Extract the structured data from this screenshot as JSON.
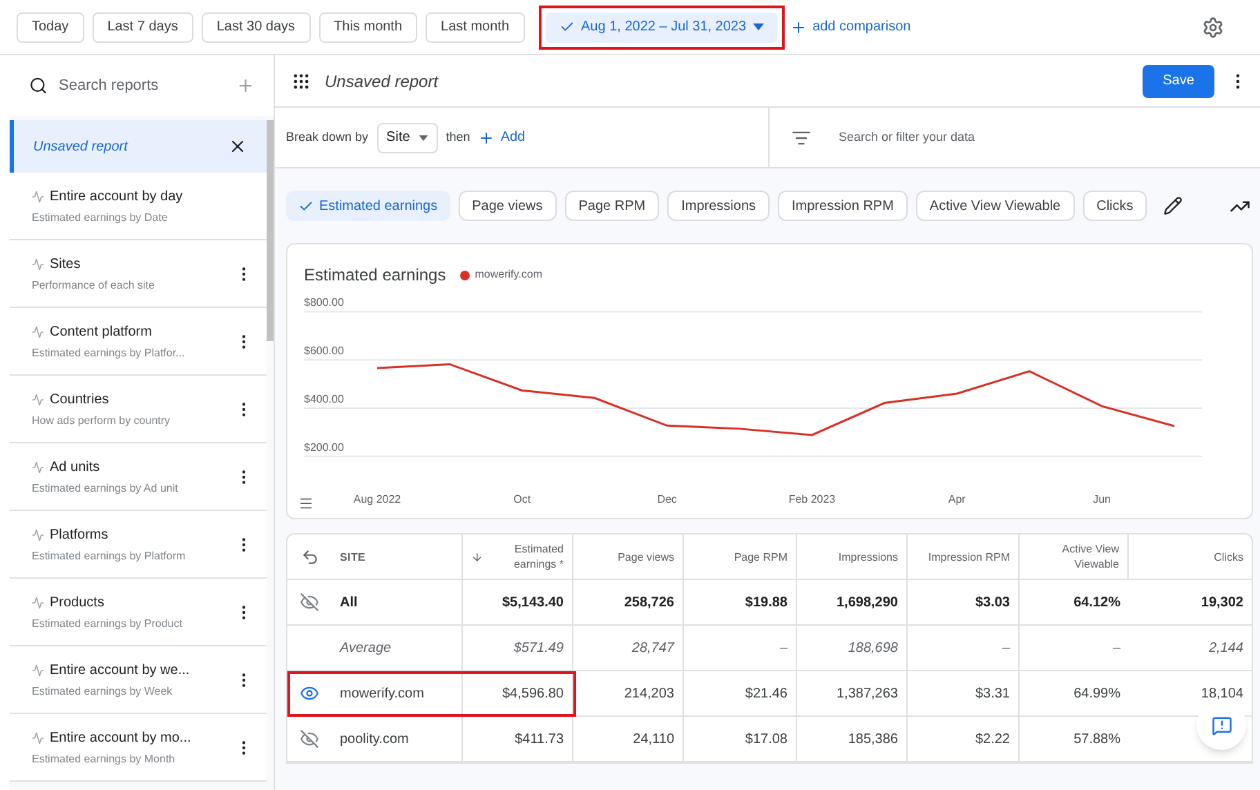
{
  "date_presets": [
    {
      "label": "Today",
      "selected": false
    },
    {
      "label": "Last 7 days",
      "selected": false
    },
    {
      "label": "Last 30 days",
      "selected": false
    },
    {
      "label": "This month",
      "selected": false
    },
    {
      "label": "Last month",
      "selected": false
    }
  ],
  "date_range": {
    "label": "Aug 1, 2022 – Jul 31, 2023",
    "selected": true,
    "highlighted": true
  },
  "add_comparison": "add comparison",
  "sidebar": {
    "search_placeholder": "Search reports",
    "active_report": "Unsaved report",
    "items": [
      {
        "title": "Entire account by day",
        "subtitle": "Estimated earnings by Date",
        "has_menu": false
      },
      {
        "title": "Sites",
        "subtitle": "Performance of each site",
        "has_menu": true
      },
      {
        "title": "Content platform",
        "subtitle": "Estimated earnings by Platfor...",
        "has_menu": true
      },
      {
        "title": "Countries",
        "subtitle": "How ads perform by country",
        "has_menu": true
      },
      {
        "title": "Ad units",
        "subtitle": "Estimated earnings by Ad unit",
        "has_menu": true
      },
      {
        "title": "Platforms",
        "subtitle": "Estimated earnings by Platform",
        "has_menu": true
      },
      {
        "title": "Products",
        "subtitle": "Estimated earnings by Product",
        "has_menu": true
      },
      {
        "title": "Entire account by we...",
        "subtitle": "Estimated earnings by Week",
        "has_menu": true
      },
      {
        "title": "Entire account by mo...",
        "subtitle": "Estimated earnings by Month",
        "has_menu": true
      }
    ]
  },
  "report": {
    "title": "Unsaved report",
    "save": "Save"
  },
  "breakdown": {
    "label": "Break down by",
    "value": "Site",
    "then": "then",
    "add": "Add",
    "filter_placeholder": "Search or filter your data"
  },
  "metrics": [
    {
      "label": "Estimated earnings",
      "selected": true
    },
    {
      "label": "Page views",
      "selected": false
    },
    {
      "label": "Page RPM",
      "selected": false
    },
    {
      "label": "Impressions",
      "selected": false
    },
    {
      "label": "Impression RPM",
      "selected": false
    },
    {
      "label": "Active View Viewable",
      "selected": false
    },
    {
      "label": "Clicks",
      "selected": false
    }
  ],
  "chart": {
    "title": "Estimated earnings",
    "chart_data": {
      "type": "line",
      "grid": true,
      "categories": [
        "Aug 2022",
        null,
        "Oct",
        null,
        "Dec",
        null,
        "Feb 2023",
        null,
        "Apr",
        null,
        "Jun",
        null
      ],
      "ylim": [
        -62,
        1085
      ],
      "yticks": [
        {
          "value": 200,
          "label": "$200.00"
        },
        {
          "value": 400,
          "label": "$400.00"
        },
        {
          "value": 600,
          "label": "$600.00"
        },
        {
          "value": 800,
          "label": "$800.00"
        }
      ],
      "series": [
        {
          "name": "mowerify.com",
          "color": "#d93025",
          "values": [
            566,
            582,
            473,
            442,
            327,
            314,
            288,
            421,
            460,
            553,
            408,
            325
          ]
        }
      ]
    }
  },
  "table": {
    "columns": [
      {
        "label": "SITE",
        "sorted": false
      },
      {
        "label": "Estimated earnings *",
        "sorted": true
      },
      {
        "label": "Page views",
        "sorted": false
      },
      {
        "label": "Page RPM",
        "sorted": false
      },
      {
        "label": "Impressions",
        "sorted": false
      },
      {
        "label": "Impression RPM",
        "sorted": false
      },
      {
        "label": "Active View Viewable",
        "sorted": false
      },
      {
        "label": "Clicks",
        "sorted": false
      }
    ],
    "rows": [
      {
        "kind": "total",
        "visible": false,
        "highlighted": false,
        "cells": [
          "All",
          "$5,143.40",
          "258,726",
          "$19.88",
          "1,698,290",
          "$3.03",
          "64.12%",
          "19,302"
        ]
      },
      {
        "kind": "average",
        "highlighted": false,
        "cells": [
          "Average",
          "$571.49",
          "28,747",
          "–",
          "188,698",
          "–",
          "–",
          "2,144"
        ]
      },
      {
        "kind": "site",
        "visible": true,
        "highlighted": true,
        "cells": [
          "mowerify.com",
          "$4,596.80",
          "214,203",
          "$21.46",
          "1,387,263",
          "$3.31",
          "64.99%",
          "18,104"
        ]
      },
      {
        "kind": "site",
        "visible": false,
        "highlighted": false,
        "cells": [
          "poolity.com",
          "$411.73",
          "24,110",
          "$17.08",
          "185,386",
          "$2.22",
          "57.88%"
        ]
      }
    ]
  }
}
